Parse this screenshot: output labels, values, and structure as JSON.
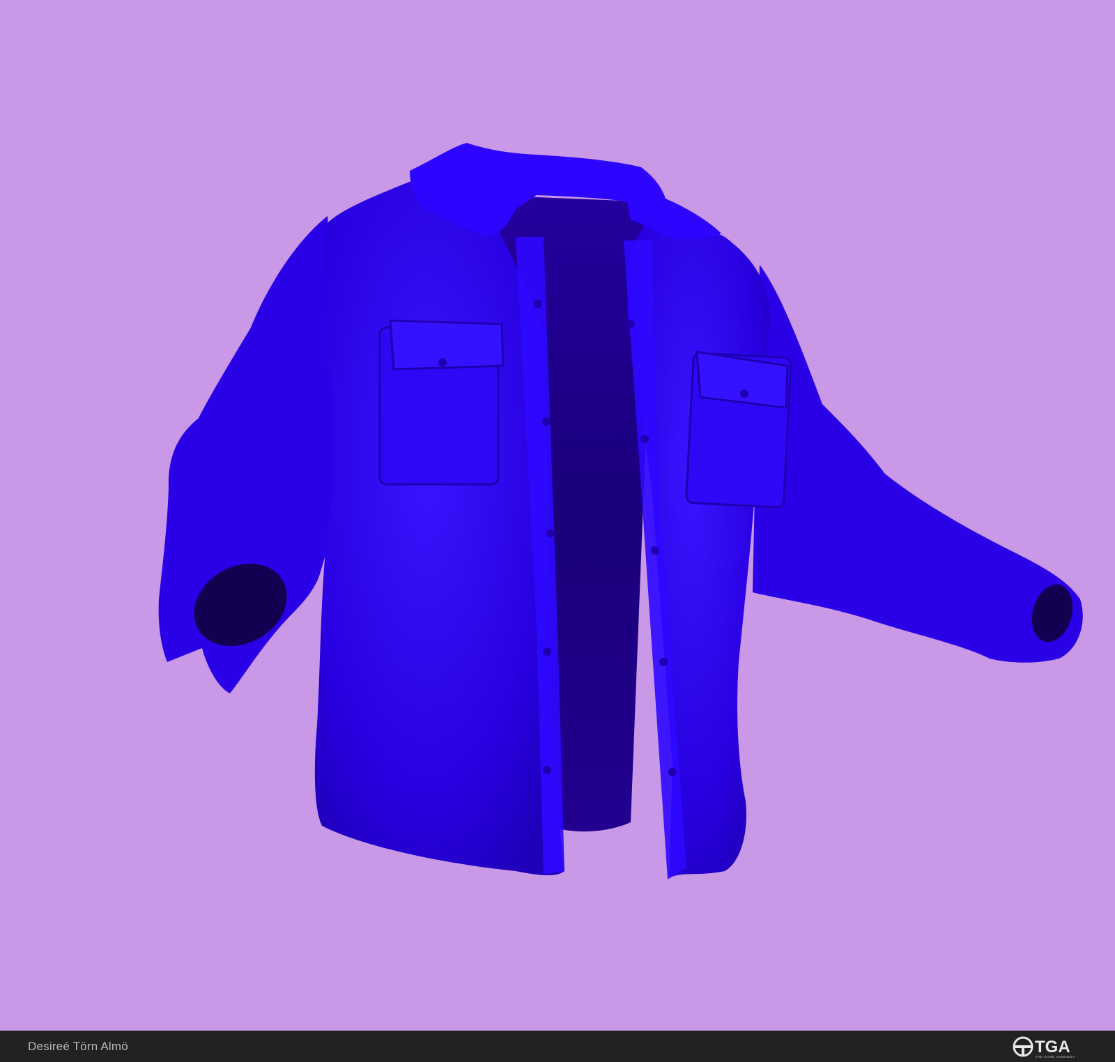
{
  "colors": {
    "background": "#c998e6",
    "footer": "#222222",
    "jacket": "#2a00e6",
    "jacket_shadow": "#1d0099",
    "jacket_interior": "#1a0080",
    "jacket_highlight": "#3b1aff"
  },
  "footer": {
    "artist_name": "Desireé Törn Almö",
    "logo_text": "TGA",
    "logo_subtext": "THE GAME ASSEMBLY"
  }
}
